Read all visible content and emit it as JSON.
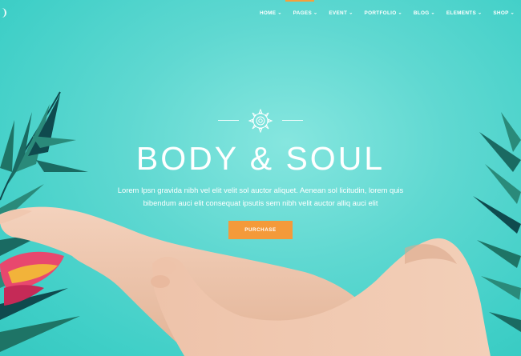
{
  "nav": {
    "items": [
      {
        "label": "HOME"
      },
      {
        "label": "PAGES"
      },
      {
        "label": "EVENT"
      },
      {
        "label": "PORTFOLIO"
      },
      {
        "label": "BLOG"
      },
      {
        "label": "ELEMENTS"
      },
      {
        "label": "SHOP"
      }
    ],
    "active_color": "#f5a03c"
  },
  "hero": {
    "title": "BODY & SOUL",
    "subtitle_line1": "Lorem Ipsn gravida nibh vel elit velit sol auctor aliquet. Aenean sol licitudin, lorem quis",
    "subtitle_line2": "bibendum auci elit consequat ipsutis sem nibh velit auctor alliq auci elit",
    "button_label": "PURCHASE",
    "button_color": "#f49a3a",
    "background_color": "#4fd3cb"
  },
  "icons": {
    "ornament": "mandala-icon",
    "chevron": "chevron-down-icon"
  }
}
